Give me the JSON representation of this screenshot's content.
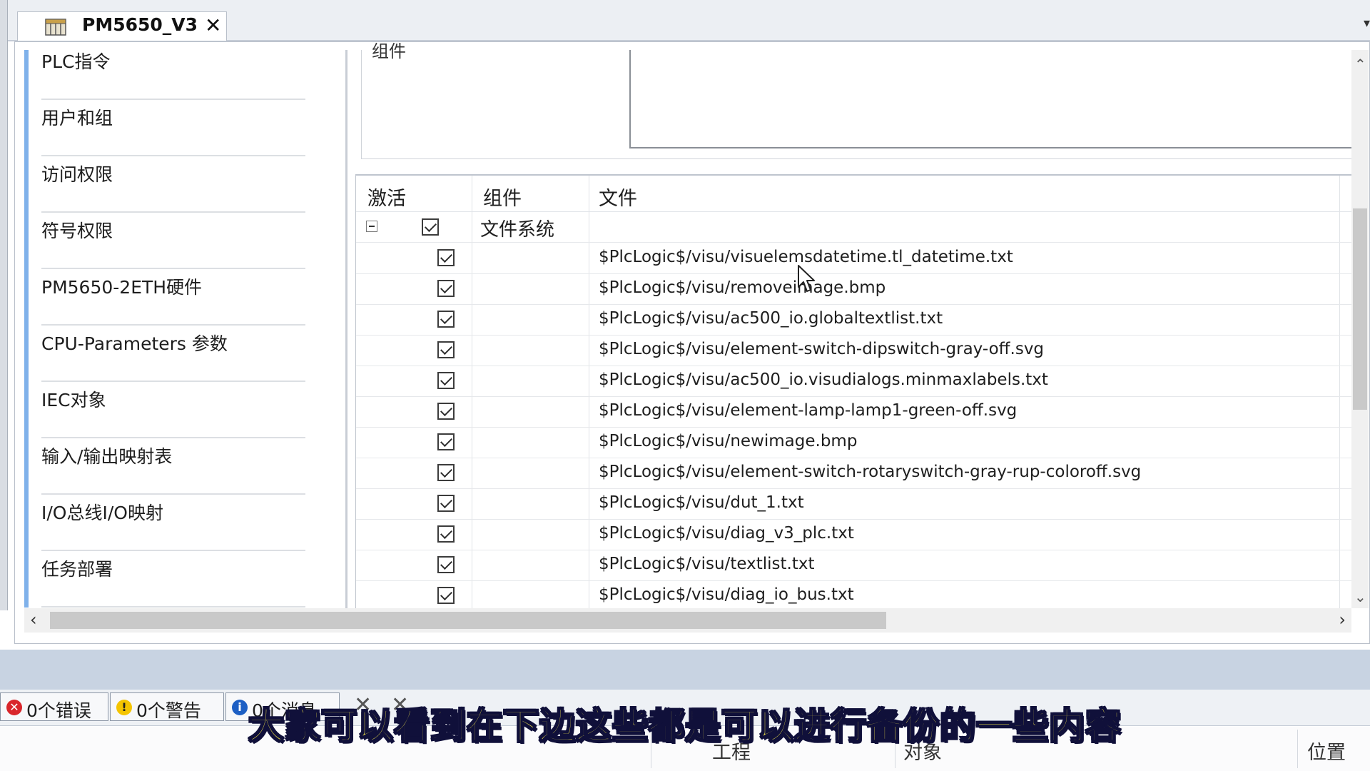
{
  "tab": {
    "title": "PM5650_V3",
    "close_glyph": "✕",
    "icon": "plc-device-icon"
  },
  "nav": {
    "items": [
      {
        "label": "PLC指令"
      },
      {
        "label": "用户和组"
      },
      {
        "label": "访问权限"
      },
      {
        "label": "符号权限"
      },
      {
        "label": "PM5650-2ETH硬件"
      },
      {
        "label": "CPU-Parameters 参数"
      },
      {
        "label": "IEC对象"
      },
      {
        "label": "输入/输出映射表"
      },
      {
        "label": "I/O总线I/O映射"
      },
      {
        "label": "任务部署"
      }
    ]
  },
  "upper": {
    "label": "组件"
  },
  "grid": {
    "headers": {
      "active": "激活",
      "component": "组件",
      "file": "文件"
    },
    "group": {
      "label": "文件系统",
      "checked": true,
      "expanded": true
    },
    "rows": [
      {
        "checked": true,
        "file": "$PlcLogic$/visu/visuelemsdatetime.tl_datetime.txt"
      },
      {
        "checked": true,
        "file": "$PlcLogic$/visu/removeimage.bmp"
      },
      {
        "checked": true,
        "file": "$PlcLogic$/visu/ac500_io.globaltextlist.txt"
      },
      {
        "checked": true,
        "file": "$PlcLogic$/visu/element-switch-dipswitch-gray-off.svg"
      },
      {
        "checked": true,
        "file": "$PlcLogic$/visu/ac500_io.visudialogs.minmaxlabels.txt"
      },
      {
        "checked": true,
        "file": "$PlcLogic$/visu/element-lamp-lamp1-green-off.svg"
      },
      {
        "checked": true,
        "file": "$PlcLogic$/visu/newimage.bmp"
      },
      {
        "checked": true,
        "file": "$PlcLogic$/visu/element-switch-rotaryswitch-gray-rup-coloroff.svg"
      },
      {
        "checked": true,
        "file": "$PlcLogic$/visu/dut_1.txt"
      },
      {
        "checked": true,
        "file": "$PlcLogic$/visu/diag_v3_plc.txt"
      },
      {
        "checked": true,
        "file": "$PlcLogic$/visu/textlist.txt"
      },
      {
        "checked": true,
        "file": "$PlcLogic$/visu/diag_io_bus.txt"
      }
    ]
  },
  "messages": {
    "errors": "0个错误",
    "warnings": "0个警告",
    "infos": "0个消息",
    "columns": {
      "project": "工程",
      "object": "对象",
      "position": "位置"
    },
    "colors": {
      "error": "#d9262b",
      "warning": "#f4c400",
      "info": "#1d5fc4"
    }
  },
  "subtitle": "大家可以看到在下边这些都是可以进行备份的一些内容"
}
